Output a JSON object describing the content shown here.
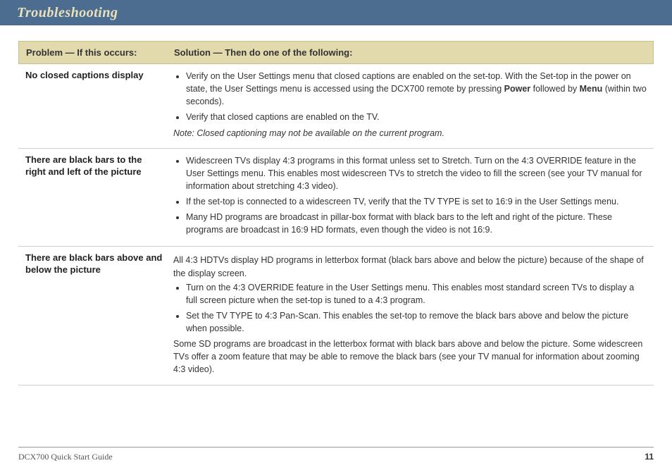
{
  "header": {
    "title": "Troubleshooting"
  },
  "table": {
    "header_col1": "Problem — If this occurs:",
    "header_col2": "Solution — Then do one of the following:",
    "rows": [
      {
        "problem": "No closed captions display",
        "b1_pre": "Verify on the User Settings menu that closed captions are enabled on the set-top. With the Set-top in the power on state, the User Settings menu is accessed using the DCX700 remote by pressing ",
        "b1_bold1": "Power",
        "b1_mid": " followed by ",
        "b1_bold2": "Menu",
        "b1_post": " (within two seconds).",
        "b2": "Verify that closed captions are enabled on the TV.",
        "note": "Note: Closed captioning may not be available on the current program."
      },
      {
        "problem": "There are black bars to the right and left of the picture",
        "b1": "Widescreen TVs display 4:3 programs in this format unless set to Stretch. Turn on the 4:3 OVERRIDE feature in the User Settings menu. This enables most widescreen TVs to stretch the video to fill the screen (see your TV manual for information about stretching 4:3 video).",
        "b2": "If the set-top is connected to a widescreen TV, verify that the TV TYPE is set to 16:9 in the User Settings menu.",
        "b3": "Many HD programs are broadcast in pillar-box format with black bars to the left and right of the picture. These programs are broadcast in 16:9 HD formats, even though the video is not 16:9."
      },
      {
        "problem": "There are black bars above and below the picture",
        "intro": "All 4:3 HDTVs display HD programs in letterbox format (black bars above and below the picture) because of the shape of the display screen.",
        "b1": "Turn on the 4:3 OVERRIDE feature in the User Settings menu. This enables most standard screen TVs to display a full screen picture when the set-top is tuned to a 4:3 program.",
        "b2": "Set the TV TYPE to 4:3 Pan-Scan. This enables the set-top to remove the black bars above and below the picture when possible.",
        "outro": "Some SD programs are broadcast in the letterbox format with black bars above and below the picture. Some widescreen TVs offer a zoom feature that may be able to remove the black bars (see your TV manual for information about zooming 4:3 video)."
      }
    ]
  },
  "footer": {
    "doc_title": "DCX700 Quick Start Guide",
    "page_number": "11"
  }
}
